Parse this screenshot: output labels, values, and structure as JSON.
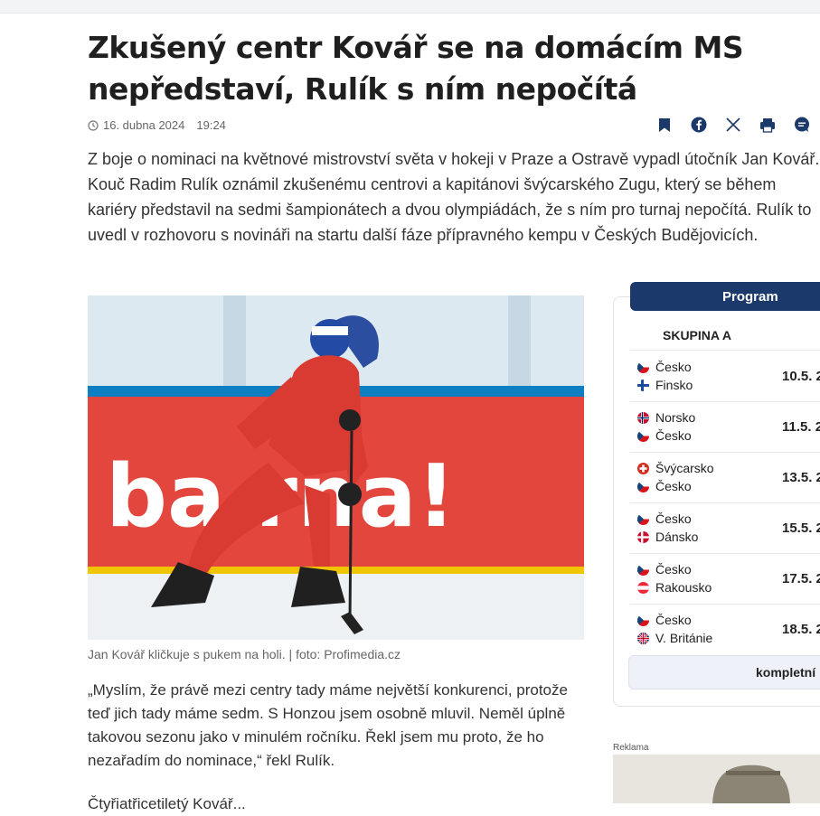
{
  "article": {
    "title": "Zkušený centr Kovář se na domácím MS nepředstaví, Rulík s ním nepočítá",
    "date": "16. dubna 2024",
    "time": "19:24",
    "perex": "Z boje o nominaci na květnové mistrovství světa v hokeji v Praze a Ostravě vypadl útočník Jan Kovář. Kouč Radim Rulík oznámil zkušenému centrovi a kapitánovi švýcarského Zugu, který se během kariéry představil na sedmi šampionátech a dvou olympiádách, že s ním pro turnaj nepočítá. Rulík to uvedl v rozhovoru s novináři na startu další fáze přípravného kempu v Českých Budějovicích.",
    "photo_banner_text": "ba rna!",
    "caption": "Jan Kovář kličkuje s pukem na holi. | foto: Profimedia.cz",
    "quote": "„Myslím, že právě mezi centry tady máme největší konkurenci, protože teď jich tady máme sedm. S Honzou jsem osobně mluvil. Neměl úplně takovou sezonu jako v minulém ročníku. Řekl jsem mu proto, že ho nezařadím do nominace,“ řekl Rulík.",
    "next_paragraph_partial": "Čtyřiatřicetiletý Kovář..."
  },
  "share_icons": [
    "bookmark-icon",
    "facebook-icon",
    "x-icon",
    "print-icon",
    "comment-icon"
  ],
  "program": {
    "header": "Program",
    "group": "SKUPINA A",
    "matches": [
      {
        "home": "Česko",
        "away": "Finsko",
        "date": "10.5. 2",
        "home_flag": "cz",
        "away_flag": "fi"
      },
      {
        "home": "Norsko",
        "away": "Česko",
        "date": "11.5. 2",
        "home_flag": "no",
        "away_flag": "cz"
      },
      {
        "home": "Švýcarsko",
        "away": "Česko",
        "date": "13.5. 2",
        "home_flag": "ch",
        "away_flag": "cz"
      },
      {
        "home": "Česko",
        "away": "Dánsko",
        "date": "15.5. 2",
        "home_flag": "cz",
        "away_flag": "dk"
      },
      {
        "home": "Česko",
        "away": "Rakousko",
        "date": "17.5. 2",
        "home_flag": "cz",
        "away_flag": "at"
      },
      {
        "home": "Česko",
        "away": "V. Británie",
        "date": "18.5. 2",
        "home_flag": "cz",
        "away_flag": "gb"
      }
    ],
    "button": "kompletní"
  },
  "ad": {
    "label": "Reklama"
  },
  "colors": {
    "navy": "#1b3a6b",
    "red": "#e23b33"
  }
}
